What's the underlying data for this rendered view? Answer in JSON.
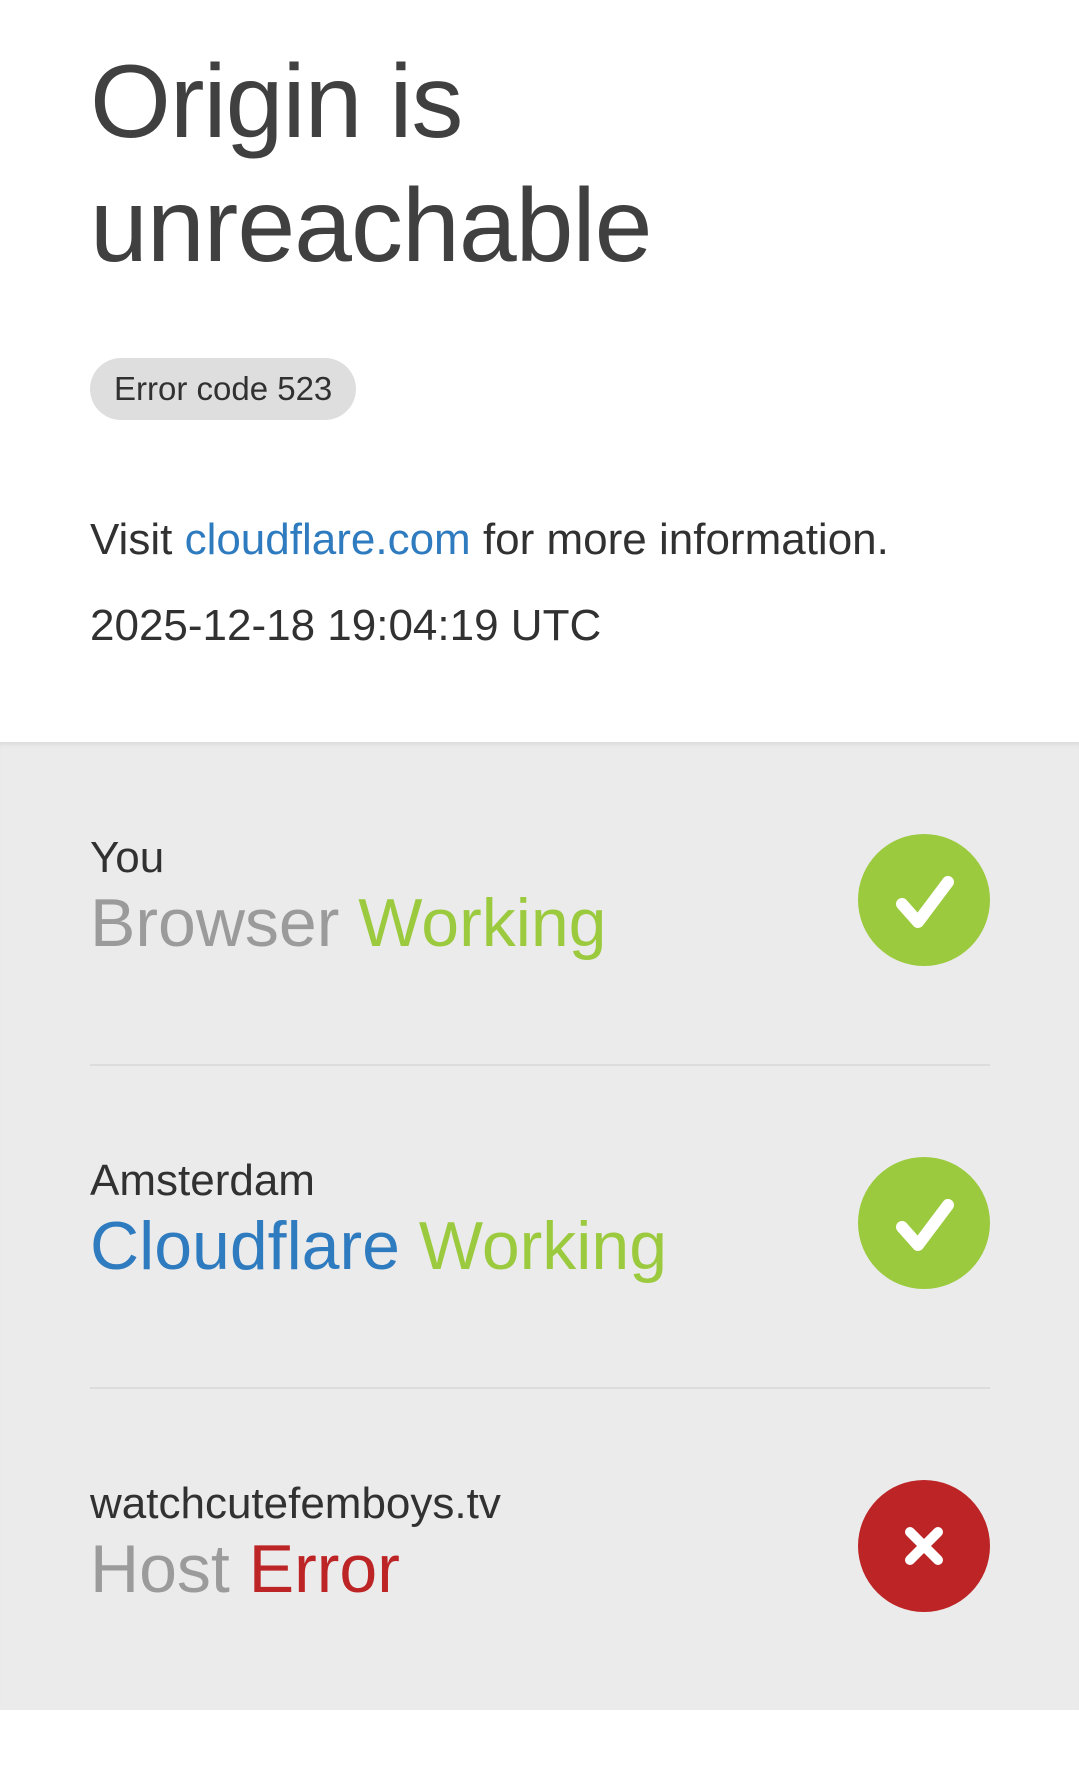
{
  "page": {
    "title": "Origin is unreachable",
    "title_line1": "Origin is",
    "title_line2": "unreachable",
    "error_code": "Error code 523",
    "visit_prefix": "Visit",
    "visit_link": "cloudflare.com",
    "visit_suffix": "for more information.",
    "timestamp": "2025-12-18 19:04:19 UTC"
  },
  "status": [
    {
      "location": "You",
      "label": "Browser",
      "state": "Working",
      "icon": "check-icon",
      "ok": true
    },
    {
      "location": "Amsterdam",
      "label": "Cloudflare",
      "state": "Working",
      "icon": "check-icon",
      "ok": true
    },
    {
      "location": "watchcutefemboys.tv",
      "label": "Host",
      "state": "Error",
      "icon": "close-icon",
      "ok": false
    }
  ],
  "colors": {
    "working": "#9bca3e",
    "error": "#bd2426",
    "link": "#2f7bbf",
    "muted_label": "#9b9b9b",
    "panel_bg": "#ebebeb"
  }
}
